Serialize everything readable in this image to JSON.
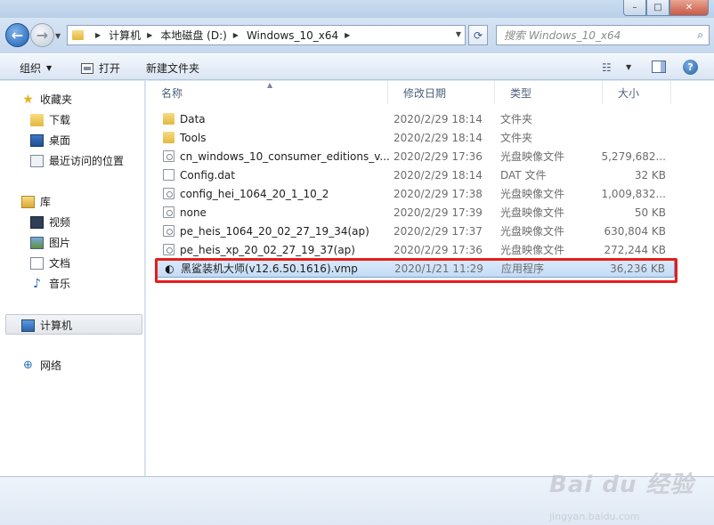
{
  "window": {
    "minimize": "–",
    "maximize": "□",
    "close": "✕"
  },
  "nav": {
    "back_icon": "←",
    "forward_icon": "→"
  },
  "address": {
    "crumbs": [
      "计算机",
      "本地磁盘 (D:)",
      "Windows_10_x64"
    ]
  },
  "search": {
    "placeholder": "搜索 Windows_10_x64"
  },
  "toolbar": {
    "organize": "组织",
    "open": "打开",
    "new_folder": "新建文件夹"
  },
  "sidebar": {
    "favorites": "收藏夹",
    "downloads": "下载",
    "desktop": "桌面",
    "recent": "最近访问的位置",
    "libraries": "库",
    "videos": "视频",
    "pictures": "图片",
    "documents": "文档",
    "music": "音乐",
    "computer": "计算机",
    "network": "网络"
  },
  "columns": {
    "name": "名称",
    "date": "修改日期",
    "type": "类型",
    "size": "大小"
  },
  "files": [
    {
      "name": "Data",
      "date": "2020/2/29 18:14",
      "type": "文件夹",
      "size": "",
      "icon": "folder-icon"
    },
    {
      "name": "Tools",
      "date": "2020/2/29 18:14",
      "type": "文件夹",
      "size": "",
      "icon": "folder-icon"
    },
    {
      "name": "cn_windows_10_consumer_editions_v...",
      "date": "2020/2/29 17:36",
      "type": "光盘映像文件",
      "size": "5,279,682...",
      "icon": "disc-image-icon"
    },
    {
      "name": "Config.dat",
      "date": "2020/2/29 18:14",
      "type": "DAT 文件",
      "size": "32 KB",
      "icon": "file-icon"
    },
    {
      "name": "config_hei_1064_20_1_10_2",
      "date": "2020/2/29 17:38",
      "type": "光盘映像文件",
      "size": "1,009,832...",
      "icon": "disc-image-icon"
    },
    {
      "name": "none",
      "date": "2020/2/29 17:39",
      "type": "光盘映像文件",
      "size": "50 KB",
      "icon": "disc-image-icon"
    },
    {
      "name": "pe_heis_1064_20_02_27_19_34(ap)",
      "date": "2020/2/29 17:37",
      "type": "光盘映像文件",
      "size": "630,804 KB",
      "icon": "disc-image-icon"
    },
    {
      "name": "pe_heis_xp_20_02_27_19_37(ap)",
      "date": "2020/2/29 17:36",
      "type": "光盘映像文件",
      "size": "272,244 KB",
      "icon": "disc-image-icon"
    },
    {
      "name": "黑鲨装机大师(v12.6.50.1616).vmp",
      "date": "2020/1/21 11:29",
      "type": "应用程序",
      "size": "36,236 KB",
      "icon": "shark-app-icon"
    }
  ],
  "watermark": {
    "logo": "Bai du 经验",
    "url": "jingyan.baidu.com"
  },
  "colors": {
    "highlight_box": "#e51d1d",
    "selection": "#c2dcf6"
  }
}
